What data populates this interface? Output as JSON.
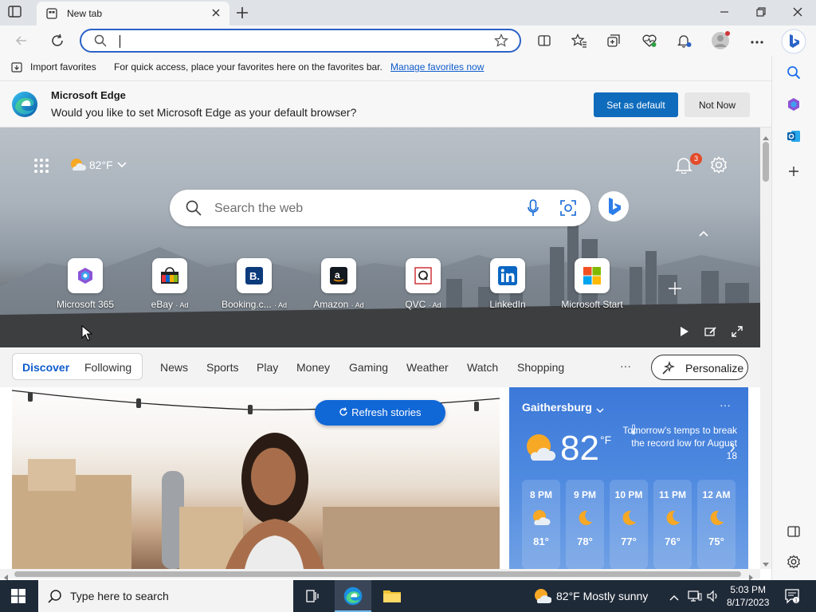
{
  "tab": {
    "title": "New tab"
  },
  "favorites_bar": {
    "import_label": "Import favorites",
    "hint": "For quick access, place your favorites here on the favorites bar.",
    "manage_link": "Manage favorites now"
  },
  "banner": {
    "title": "Microsoft Edge",
    "message": "Would you like to set Microsoft Edge as your default browser?",
    "primary": "Set as default",
    "secondary": "Not Now"
  },
  "hero": {
    "weather": "82°F",
    "search_placeholder": "Search the web",
    "notification_count": "3"
  },
  "quick_links": [
    {
      "label": "Microsoft 365",
      "ad": ""
    },
    {
      "label": "eBay",
      "ad": "· Ad"
    },
    {
      "label": "Booking.c...",
      "ad": "· Ad"
    },
    {
      "label": "Amazon",
      "ad": "· Ad"
    },
    {
      "label": "QVC",
      "ad": "· Ad"
    },
    {
      "label": "LinkedIn",
      "ad": ""
    },
    {
      "label": "Microsoft Start",
      "ad": ""
    }
  ],
  "feed_nav": {
    "items": [
      "Discover",
      "Following",
      "News",
      "Sports",
      "Play",
      "Money",
      "Gaming",
      "Weather",
      "Watch",
      "Shopping"
    ],
    "more": "···",
    "personalize": "Personalize"
  },
  "story": {
    "refresh_label": "Refresh stories"
  },
  "weather_card": {
    "city": "Gaithersburg",
    "more": "···",
    "temp": "82",
    "unit": "°F",
    "note": "Tomorrow's temps to break the record low for August 18",
    "hours": [
      {
        "time": "8 PM",
        "temp": "81°",
        "icon": "partly-cloudy-night-icon"
      },
      {
        "time": "9 PM",
        "temp": "78°",
        "icon": "moon-icon"
      },
      {
        "time": "10 PM",
        "temp": "77°",
        "icon": "moon-icon"
      },
      {
        "time": "11 PM",
        "temp": "76°",
        "icon": "moon-icon"
      },
      {
        "time": "12 AM",
        "temp": "75°",
        "icon": "moon-icon"
      }
    ]
  },
  "taskbar": {
    "search_placeholder": "Type here to search",
    "weather": "82°F  Mostly sunny",
    "time": "5:03 PM",
    "date": "8/17/2023"
  },
  "colors": {
    "accent": "#0f6cbd",
    "taskbar": "#1f2a38",
    "weather_card": "#3c78d8"
  }
}
